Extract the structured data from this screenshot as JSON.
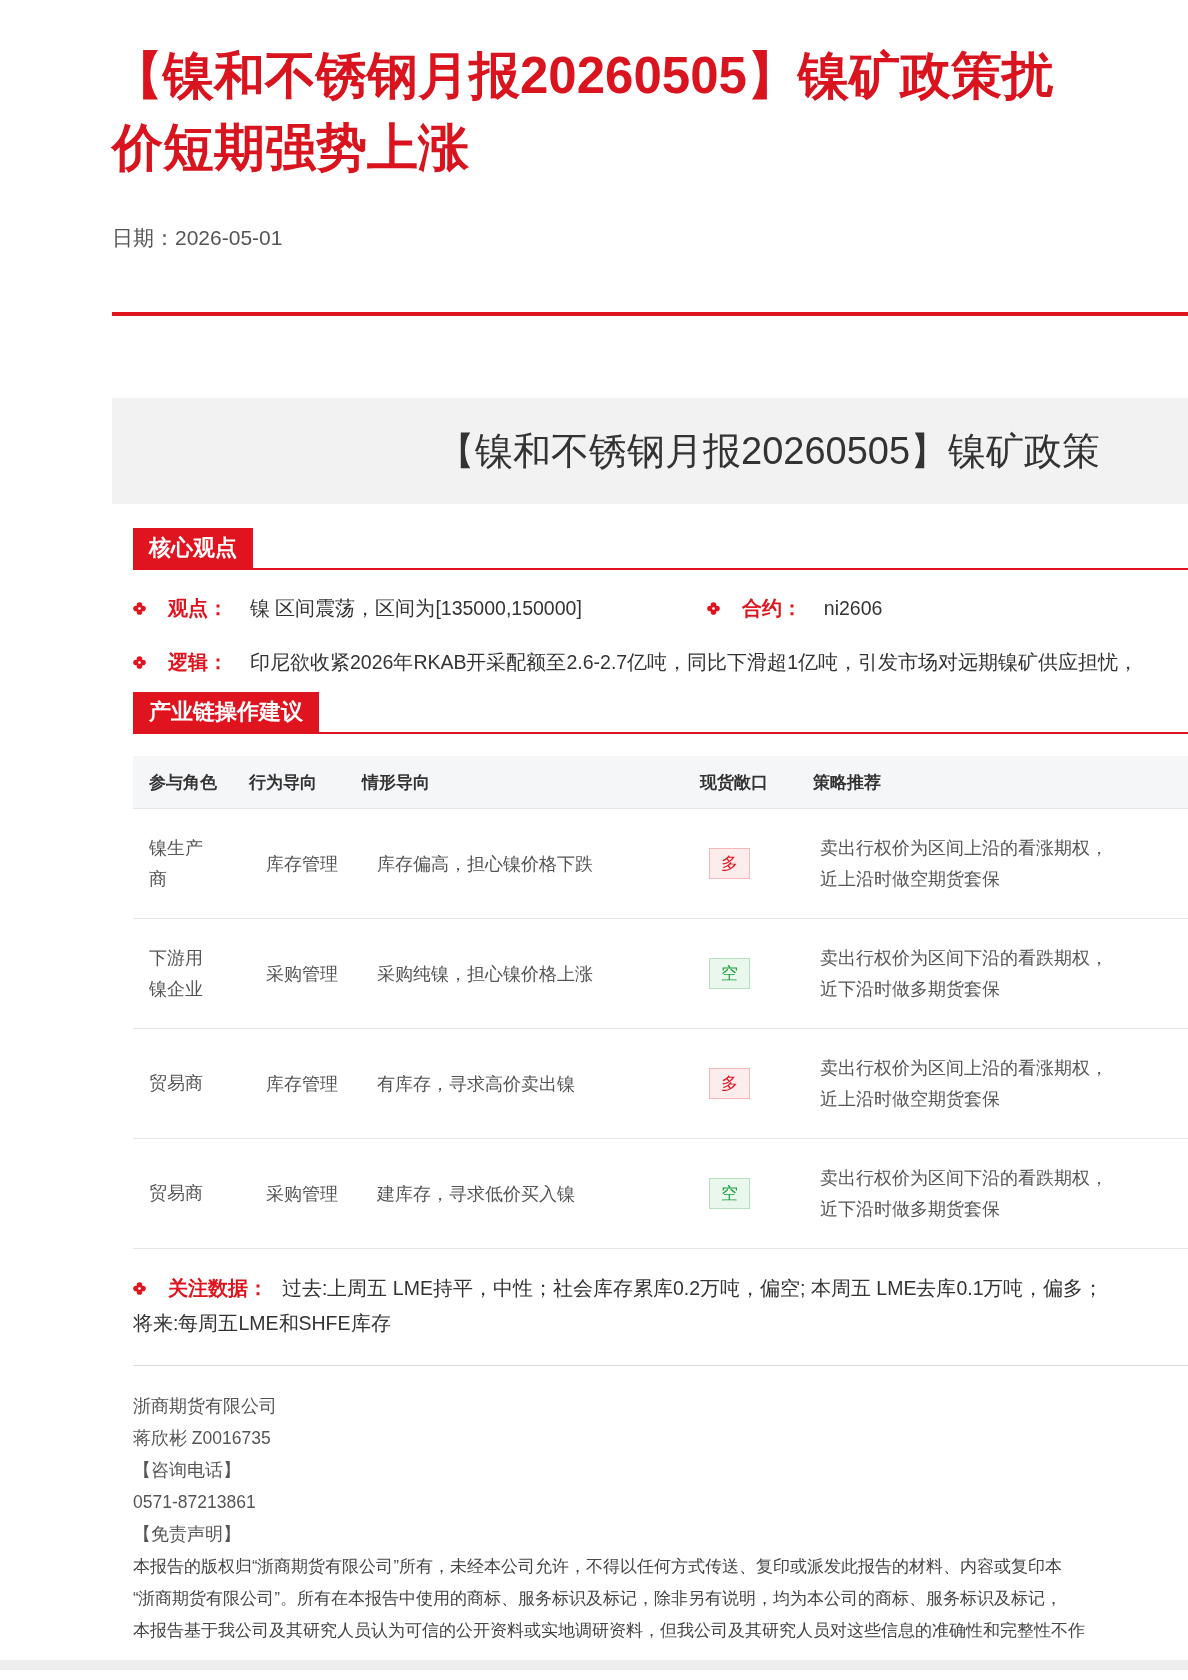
{
  "title_lines": [
    "【镍和不锈钢月报20260505】镍矿政策扰",
    "价短期强势上涨"
  ],
  "date": {
    "label": "日期：",
    "value": "2026-05-01"
  },
  "banner": "【镍和不锈钢月报20260505】镍矿政策",
  "sections": [
    {
      "heading": "核心观点"
    },
    {
      "heading": "产业链操作建议"
    }
  ],
  "view": {
    "label": "观点：",
    "text": "镍 区间震荡，区间为[135000,150000]"
  },
  "contract": {
    "label": "合约：",
    "text": "ni2606"
  },
  "logic": {
    "label": "逻辑：",
    "text": "印尼欲收紧2026年RKAB开采配额至2.6-2.7亿吨，同比下滑超1亿吨，引发市场对远期镍矿供应担忧，"
  },
  "table": {
    "columns": [
      "参与角色",
      "行为导向",
      "情形导向",
      "现货敞口",
      "策略推荐"
    ],
    "rows": [
      {
        "role": "镍生产商",
        "behavior": "库存管理",
        "situation": "库存偏高，担心镍价格下跌",
        "exposure": {
          "text": "多",
          "kind": "long"
        },
        "strategy": [
          "卖出行权价为区间上沿的看涨期权，",
          "近上沿时做空期货套保"
        ]
      },
      {
        "role": "下游用镍企业",
        "behavior": "采购管理",
        "situation": "采购纯镍，担心镍价格上涨",
        "exposure": {
          "text": "空",
          "kind": "short"
        },
        "strategy": [
          "卖出行权价为区间下沿的看跌期权，",
          "近下沿时做多期货套保"
        ]
      },
      {
        "role": "贸易商",
        "behavior": "库存管理",
        "situation": "有库存，寻求高价卖出镍",
        "exposure": {
          "text": "多",
          "kind": "long"
        },
        "strategy": [
          "卖出行权价为区间上沿的看涨期权，",
          "近上沿时做空期货套保"
        ]
      },
      {
        "role": "贸易商",
        "behavior": "采购管理",
        "situation": "建库存，寻求低价买入镍",
        "exposure": {
          "text": "空",
          "kind": "short"
        },
        "strategy": [
          "卖出行权价为区间下沿的看跌期权，",
          "近下沿时做多期货套保"
        ]
      }
    ]
  },
  "focus": {
    "label": "关注数据：",
    "lines": [
      "过去:上周五 LME持平，中性；社会库存累库0.2万吨，偏空; 本周五 LME去库0.1万吨，偏多；",
      "将来:每周五LME和SHFE库存"
    ]
  },
  "footer": [
    "浙商期货有限公司",
    "蒋欣彬 Z0016735",
    "【咨询电话】",
    "0571-87213861",
    "【免责声明】"
  ],
  "disclaimer": [
    "本报告的版权归“浙商期货有限公司”所有，未经本公司允许，不得以任何方式传送、复印或派发此报告的材料、内容或复印本",
    "“浙商期货有限公司”。所有在本报告中使用的商标、服务标识及标记，除非另有说明，均为本公司的商标、服务标识及标记，",
    "本报告基于我公司及其研究人员认为可信的公开资料或实地调研资料，但我公司及其研究人员对这些信息的准确性和完整性不作"
  ]
}
